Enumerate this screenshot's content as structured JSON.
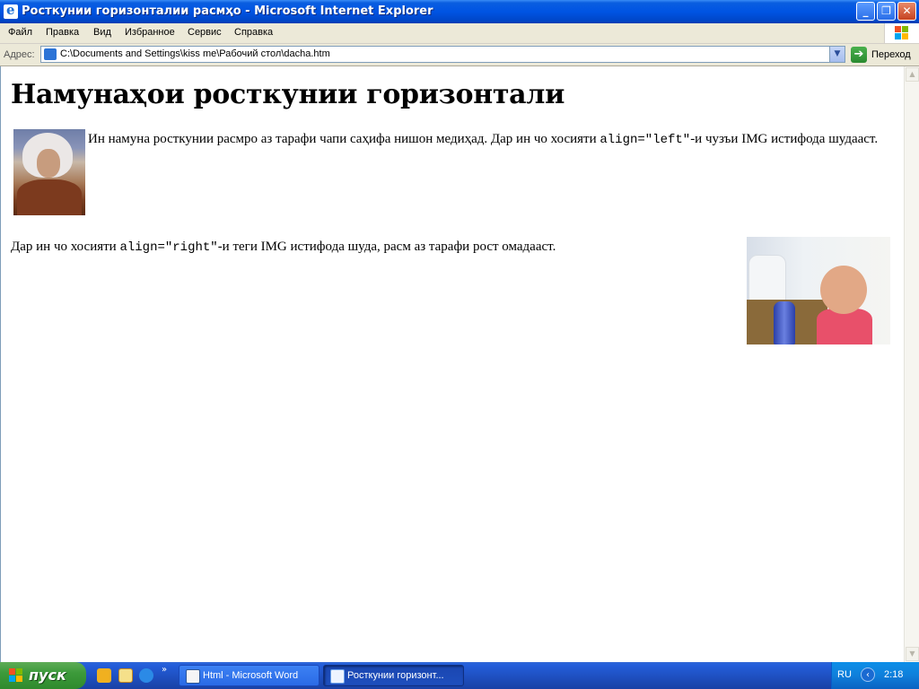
{
  "window": {
    "title": "Росткунии горизонталии расмҳо - Microsoft Internet Explorer",
    "buttons": {
      "minimize": "_",
      "maximize": "❐",
      "close": "✕"
    }
  },
  "menu": {
    "items": [
      "Файл",
      "Правка",
      "Вид",
      "Избранное",
      "Сервис",
      "Справка"
    ]
  },
  "address": {
    "label": "Адрес:",
    "url": "C:\\Documents and Settings\\kiss me\\Рабочий стол\\dacha.htm",
    "go_label": "Переход"
  },
  "page": {
    "heading": "Намунаҳои росткунии горизонтали",
    "para1": {
      "before": "Ин намуна росткунии расмро аз тарафи чапи саҳифа нишон медиҳад. Дар ин чо хосияти ",
      "code": "align=\"left\"",
      "after": "-и чузъи IMG истифода шудааст."
    },
    "para2": {
      "before": "Дар ин чо хосияти ",
      "code": "align=\"right\"",
      "after": "-и теги IMG истифода шуда, расм аз тарафи рост омадааст."
    }
  },
  "taskbar": {
    "start_label": "пуск",
    "tasks": [
      {
        "label": "Html - Microsoft Word",
        "icon": "word-icon"
      },
      {
        "label": "Росткунии горизонт...",
        "icon": "ie-icon"
      }
    ],
    "tray": {
      "language": "RU",
      "clock": "2:18"
    }
  },
  "colors": {
    "titlebar": "#0054e3",
    "taskbar": "#245edb",
    "start_button": "#3c9a3a"
  }
}
